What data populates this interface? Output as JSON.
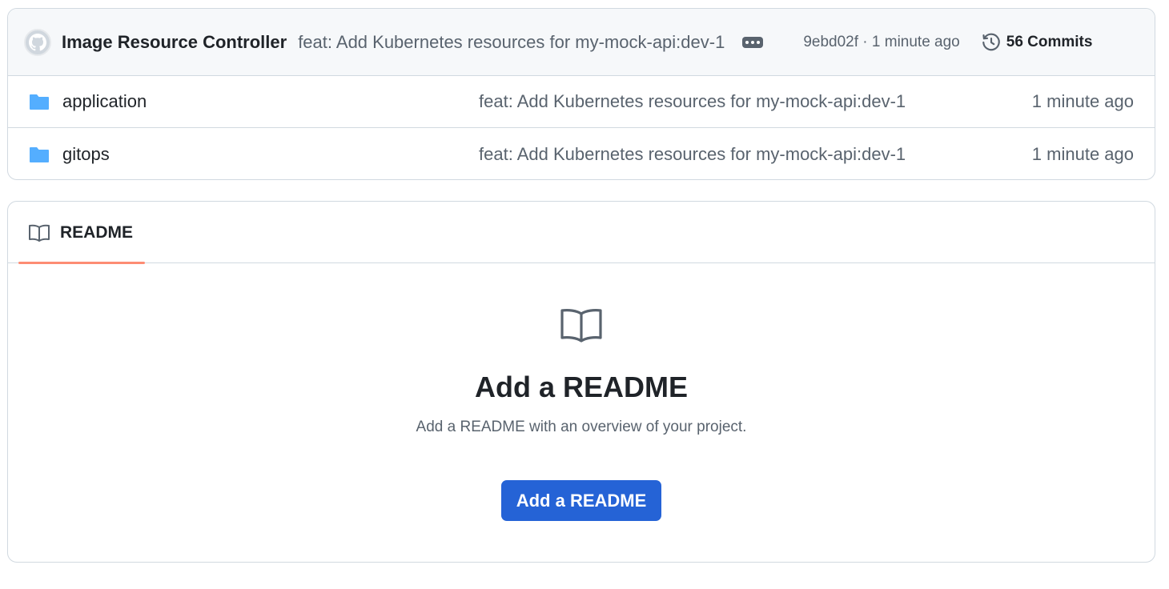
{
  "latest_commit": {
    "author": "Image Resource Controller",
    "message": "feat: Add Kubernetes resources for my-mock-api:dev-1",
    "meta": "9ebd02f · 1 minute ago",
    "commits_label": "56 Commits"
  },
  "files": [
    {
      "name": "application",
      "type": "folder",
      "commit": "feat: Add Kubernetes resources for my-mock-api:dev-1",
      "time": "1 minute ago"
    },
    {
      "name": "gitops",
      "type": "folder",
      "commit": "feat: Add Kubernetes resources for my-mock-api:dev-1",
      "time": "1 minute ago"
    }
  ],
  "readme": {
    "tab_label": "README",
    "title": "Add a README",
    "description": "Add a README with an overview of your project.",
    "button_label": "Add a README"
  },
  "icons": {
    "avatar": "github-avatar-icon",
    "more": "ellipsis-icon",
    "history": "history-icon",
    "folder": "folder-icon",
    "book": "book-icon"
  },
  "colors": {
    "folder": "#54aeff",
    "tab_underline": "#fd8c73",
    "primary_button": "#2563d6"
  }
}
